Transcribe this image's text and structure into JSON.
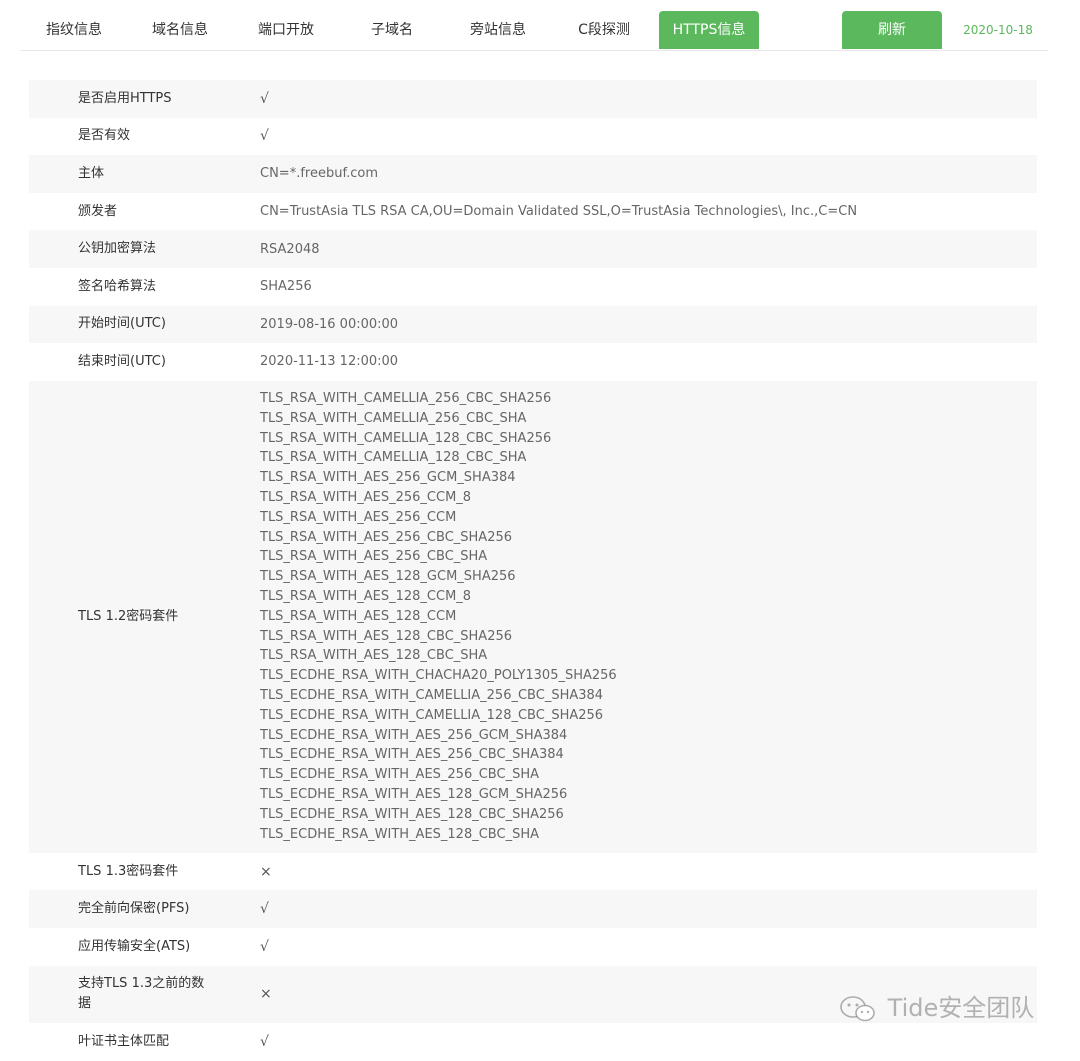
{
  "tabs": [
    {
      "label": "指纹信息"
    },
    {
      "label": "域名信息"
    },
    {
      "label": "端口开放"
    },
    {
      "label": "子域名"
    },
    {
      "label": "旁站信息"
    },
    {
      "label": "C段探测"
    },
    {
      "label": "HTTPS信息"
    }
  ],
  "active_tab": "HTTPS信息",
  "refresh_label": "刷新",
  "date": "2020-10-18",
  "colors": {
    "accent": "#5cb85c",
    "row_stripe": "#f7f7f7",
    "text_primary": "#333333",
    "text_secondary": "#666666"
  },
  "info": {
    "https_enabled": {
      "label": "是否启用HTTPS",
      "value": "√"
    },
    "valid": {
      "label": "是否有效",
      "value": "√"
    },
    "subject": {
      "label": "主体",
      "value": "CN=*.freebuf.com"
    },
    "issuer": {
      "label": "颁发者",
      "value": "CN=TrustAsia TLS RSA CA,OU=Domain Validated SSL,O=TrustAsia Technologies\\, Inc.,C=CN"
    },
    "pubkey_algo": {
      "label": "公钥加密算法",
      "value": "RSA2048"
    },
    "sig_hash_algo": {
      "label": "签名哈希算法",
      "value": "SHA256"
    },
    "start_time": {
      "label": "开始时间(UTC)",
      "value": "2019-08-16 00:00:00"
    },
    "end_time": {
      "label": "结束时间(UTC)",
      "value": "2020-11-13 12:00:00"
    },
    "tls12_suites": {
      "label": "TLS 1.2密码套件",
      "values": [
        "TLS_RSA_WITH_CAMELLIA_256_CBC_SHA256",
        "TLS_RSA_WITH_CAMELLIA_256_CBC_SHA",
        "TLS_RSA_WITH_CAMELLIA_128_CBC_SHA256",
        "TLS_RSA_WITH_CAMELLIA_128_CBC_SHA",
        "TLS_RSA_WITH_AES_256_GCM_SHA384",
        "TLS_RSA_WITH_AES_256_CCM_8",
        "TLS_RSA_WITH_AES_256_CCM",
        "TLS_RSA_WITH_AES_256_CBC_SHA256",
        "TLS_RSA_WITH_AES_256_CBC_SHA",
        "TLS_RSA_WITH_AES_128_GCM_SHA256",
        "TLS_RSA_WITH_AES_128_CCM_8",
        "TLS_RSA_WITH_AES_128_CCM",
        "TLS_RSA_WITH_AES_128_CBC_SHA256",
        "TLS_RSA_WITH_AES_128_CBC_SHA",
        "TLS_ECDHE_RSA_WITH_CHACHA20_POLY1305_SHA256",
        "TLS_ECDHE_RSA_WITH_CAMELLIA_256_CBC_SHA384",
        "TLS_ECDHE_RSA_WITH_CAMELLIA_128_CBC_SHA256",
        "TLS_ECDHE_RSA_WITH_AES_256_GCM_SHA384",
        "TLS_ECDHE_RSA_WITH_AES_256_CBC_SHA384",
        "TLS_ECDHE_RSA_WITH_AES_256_CBC_SHA",
        "TLS_ECDHE_RSA_WITH_AES_128_GCM_SHA256",
        "TLS_ECDHE_RSA_WITH_AES_128_CBC_SHA256",
        "TLS_ECDHE_RSA_WITH_AES_128_CBC_SHA"
      ]
    },
    "tls13_suites": {
      "label": "TLS 1.3密码套件",
      "value": "×"
    },
    "pfs": {
      "label": "完全前向保密(PFS)",
      "value": "√"
    },
    "ats": {
      "label": "应用传输安全(ATS)",
      "value": "√"
    },
    "pre_tls13_data": {
      "label": "支持TLS 1.3之前的数据",
      "value": "×"
    },
    "leaf_subject_match": {
      "label": "叶证书主体匹配",
      "value": "√"
    }
  },
  "watermark": {
    "icon": "wechat-icon",
    "text": "Tide安全团队"
  }
}
